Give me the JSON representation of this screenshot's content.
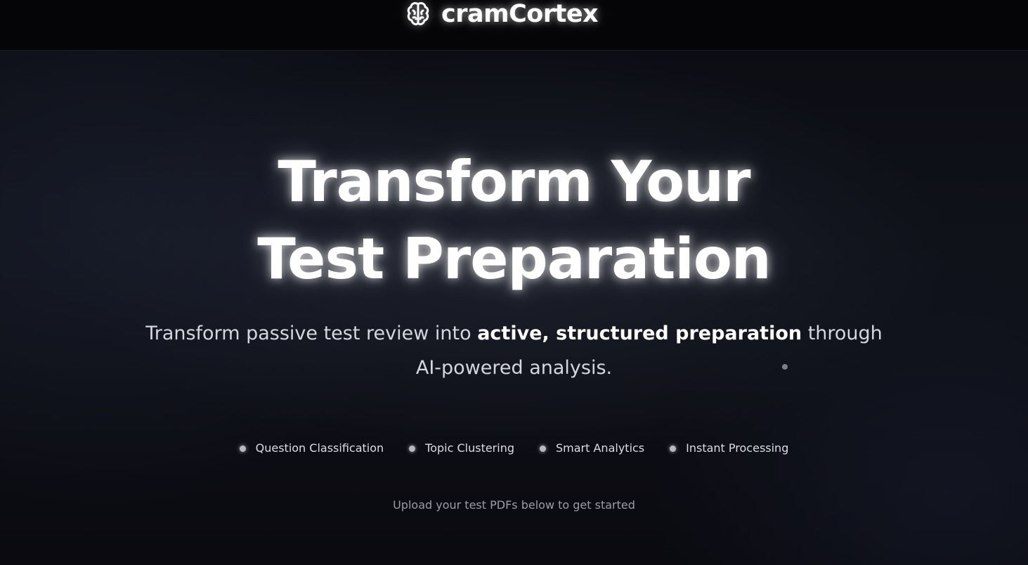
{
  "header": {
    "brand_name": "cramCortex",
    "logo_icon": "brain-icon"
  },
  "hero": {
    "title_line1": "Transform Your",
    "title_line2": "Test Preparation",
    "subtitle_before": "Transform passive test review into ",
    "subtitle_bold": "active, structured preparation",
    "subtitle_after": " through AI-powered analysis."
  },
  "features": [
    {
      "label": "Question Classification",
      "icon": "bullet-dot"
    },
    {
      "label": "Topic Clustering",
      "icon": "bullet-dot"
    },
    {
      "label": "Smart Analytics",
      "icon": "bullet-dot"
    },
    {
      "label": "Instant Processing",
      "icon": "bullet-dot"
    }
  ],
  "upload_hint": "Upload your test PDFs below to get started",
  "colors": {
    "background": "#0b0c12",
    "header_background": "#050507",
    "text_primary": "#ffffff",
    "text_secondary": "#d5d6de",
    "text_muted": "#9b9ca8"
  }
}
